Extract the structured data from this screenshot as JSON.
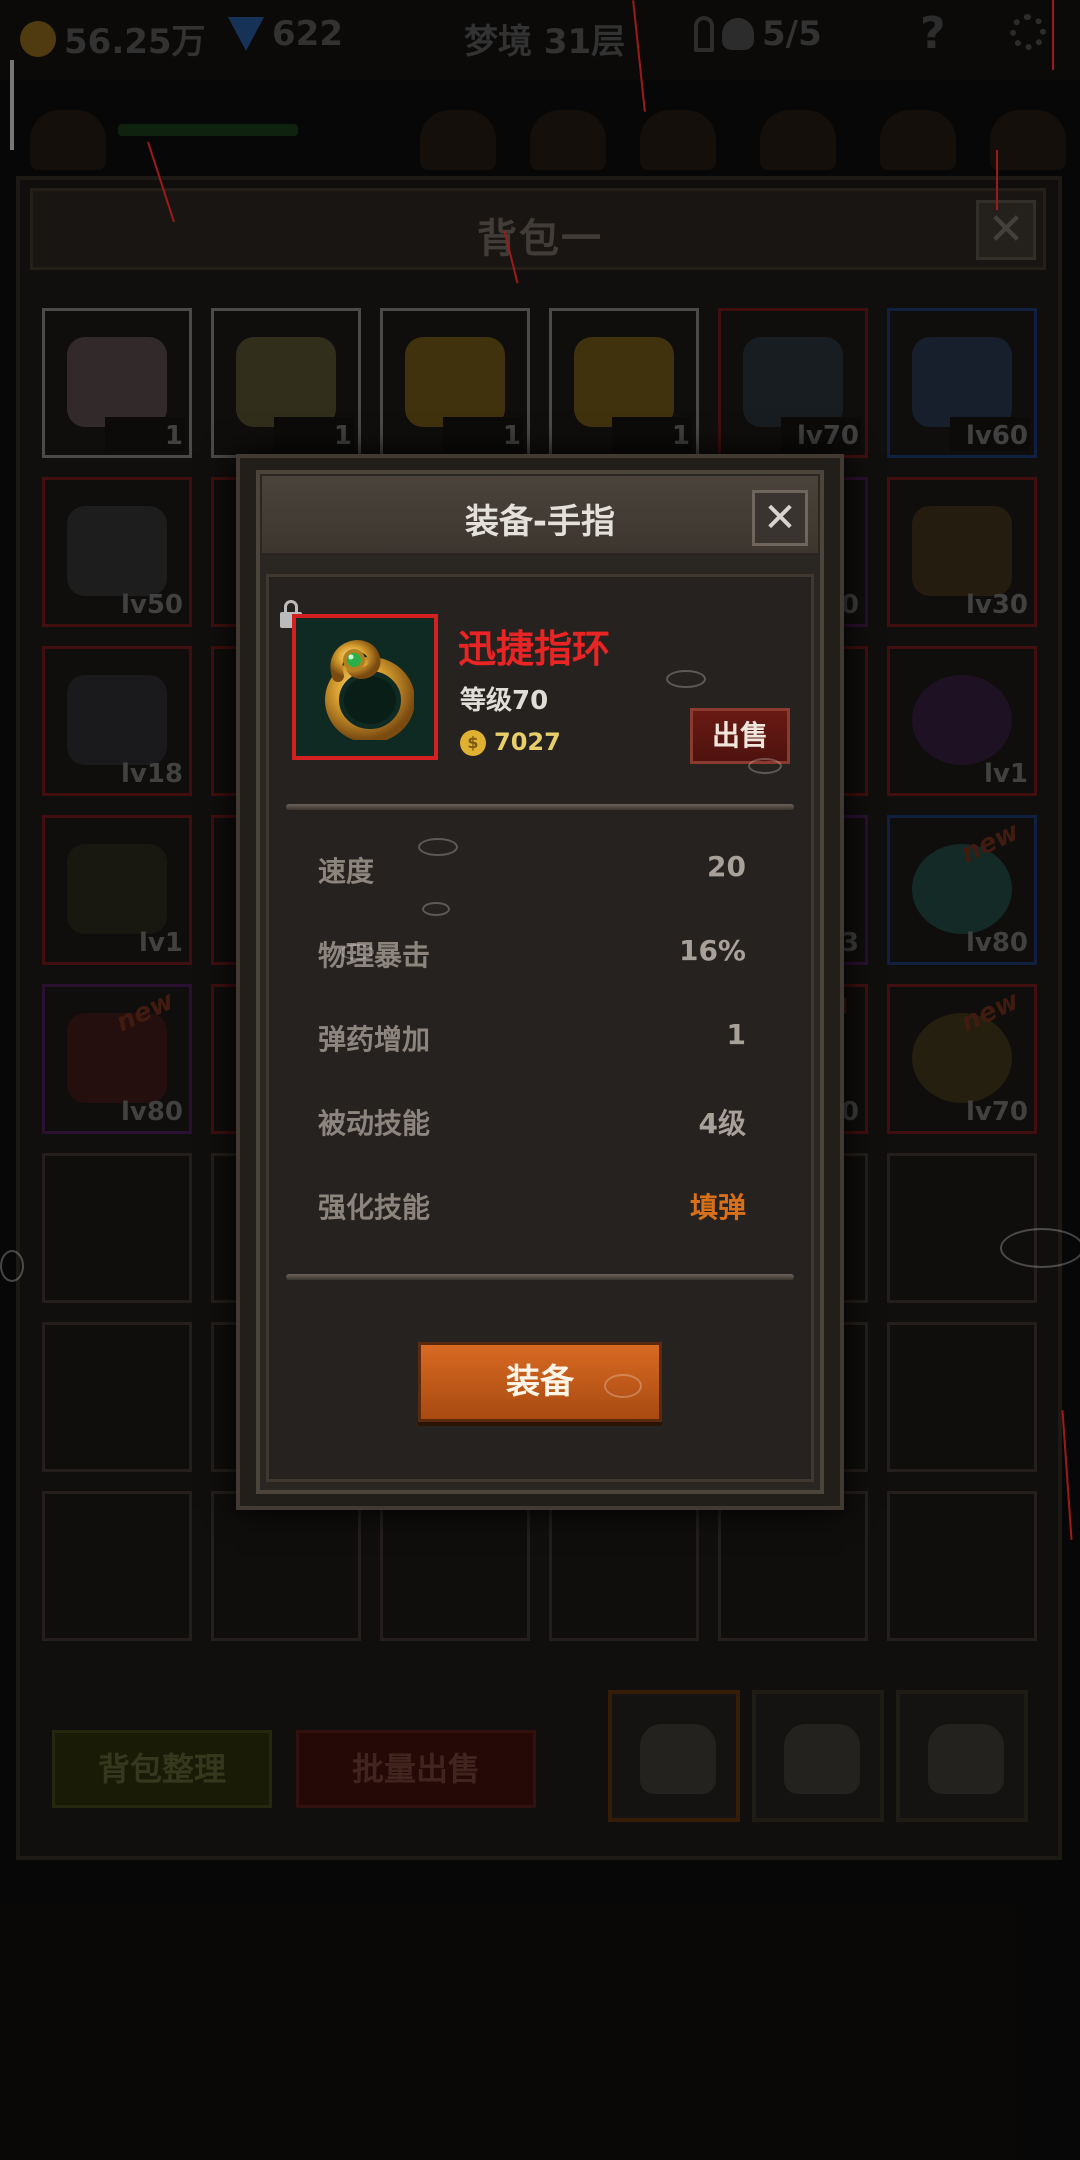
{
  "topbar": {
    "gold": "56.25万",
    "gems": "622",
    "stage": "梦境 31层",
    "skull_count": "5/5",
    "help": "?"
  },
  "backpack": {
    "title": "背包一",
    "close": "✕",
    "slots_row1": [
      {
        "badge": "1",
        "type": "cake"
      },
      {
        "badge": "1",
        "type": "beer"
      },
      {
        "badge": "1",
        "type": "cheese"
      },
      {
        "badge": "1",
        "type": "cheese"
      },
      {
        "badge": "lv70",
        "type": "dagger"
      },
      {
        "badge": "lv60",
        "type": "axe"
      }
    ],
    "slots_row2": [
      {
        "badge": "lv50"
      },
      {
        "badge": "0"
      },
      {
        "badge": "lv30"
      }
    ],
    "slots_row3": [
      {
        "badge": "lv18"
      },
      {
        "badge": "lv1"
      }
    ],
    "slots_row4": [
      {
        "badge": "lv1"
      },
      {
        "badge": "3"
      },
      {
        "badge": "lv80",
        "new": "new"
      }
    ],
    "slots_row5": [
      {
        "badge": "lv80",
        "new": "new"
      },
      {
        "badge": "0",
        "new": "ew"
      },
      {
        "badge": "lv70",
        "new": "new"
      }
    ],
    "sort_button": "背包整理",
    "batch_sell_button": "批量出售"
  },
  "dialog": {
    "title": "装备-手指",
    "close": "✕",
    "item_name": "迅捷指环",
    "item_level": "等级70",
    "item_price": "7027",
    "coin_symbol": "$",
    "sell_button": "出售",
    "stats": [
      {
        "label": "速度",
        "value": "20"
      },
      {
        "label": "物理暴击",
        "value": "16%"
      },
      {
        "label": "弹药增加",
        "value": "1"
      },
      {
        "label": "被动技能",
        "value": "4级"
      },
      {
        "label": "强化技能",
        "value": "填弹"
      }
    ],
    "equip_button": "装备"
  },
  "colors": {
    "item_name": "#e82424",
    "accent_orange": "#d8701a",
    "rarity_red": "#d42020"
  },
  "icons": [
    "gold-coin-icon",
    "gem-icon",
    "key-icon",
    "skull-icon",
    "help-icon",
    "settings-icon",
    "lock-icon",
    "ring-icon",
    "coin-icon",
    "bag-icon"
  ]
}
